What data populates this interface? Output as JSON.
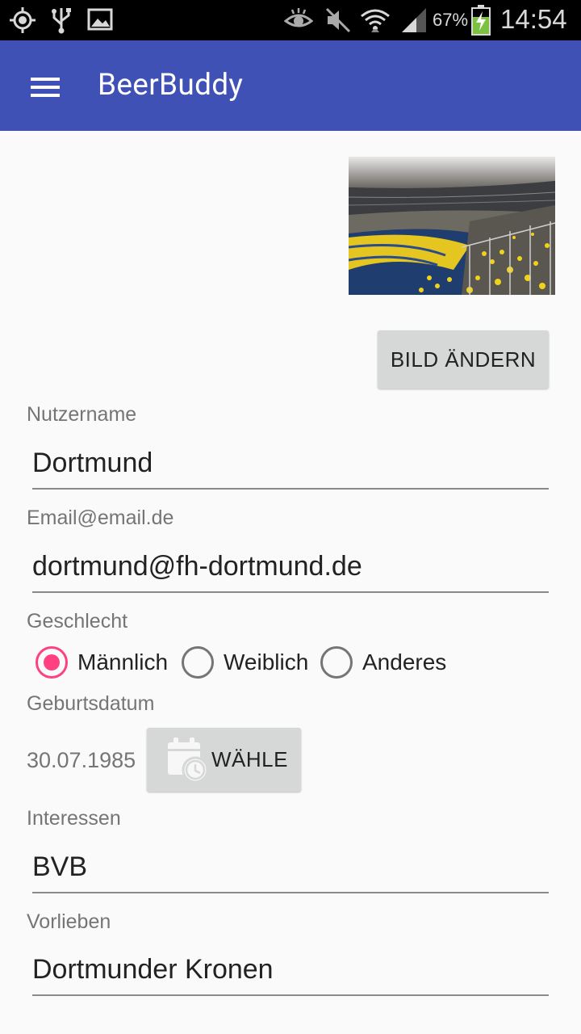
{
  "status_bar": {
    "battery_percent": "67%",
    "time": "14:54",
    "icons": [
      "gps-icon",
      "usb-icon",
      "image-icon",
      "eye-icon",
      "mute-icon",
      "wifi-icon",
      "signal-icon",
      "battery-charging-icon"
    ]
  },
  "app_bar": {
    "title": "BeerBuddy",
    "menu_icon": "hamburger-menu-icon",
    "color": "#3f51b5"
  },
  "profile": {
    "image_alt": "stadium-photo",
    "change_button": "BILD ÄNDERN"
  },
  "form": {
    "username_label": "Nutzername",
    "username_value": "Dortmund",
    "email_label": "Email@email.de",
    "email_value": "dortmund@fh-dortmund.de",
    "gender_label": "Geschlecht",
    "gender_options": [
      {
        "label": "Männlich",
        "checked": true
      },
      {
        "label": "Weiblich",
        "checked": false
      },
      {
        "label": "Anderes",
        "checked": false
      }
    ],
    "birthdate_label": "Geburtsdatum",
    "birthdate_value": "30.07.1985",
    "birthdate_button": "WÄHLE",
    "interests_label": "Interessen",
    "interests_value": "BVB",
    "preferences_label": "Vorlieben",
    "preferences_value": "Dortmunder Kronen"
  },
  "colors": {
    "accent": "#ff4081",
    "primary": "#3f51b5",
    "button_bg": "#d6d7d7"
  }
}
